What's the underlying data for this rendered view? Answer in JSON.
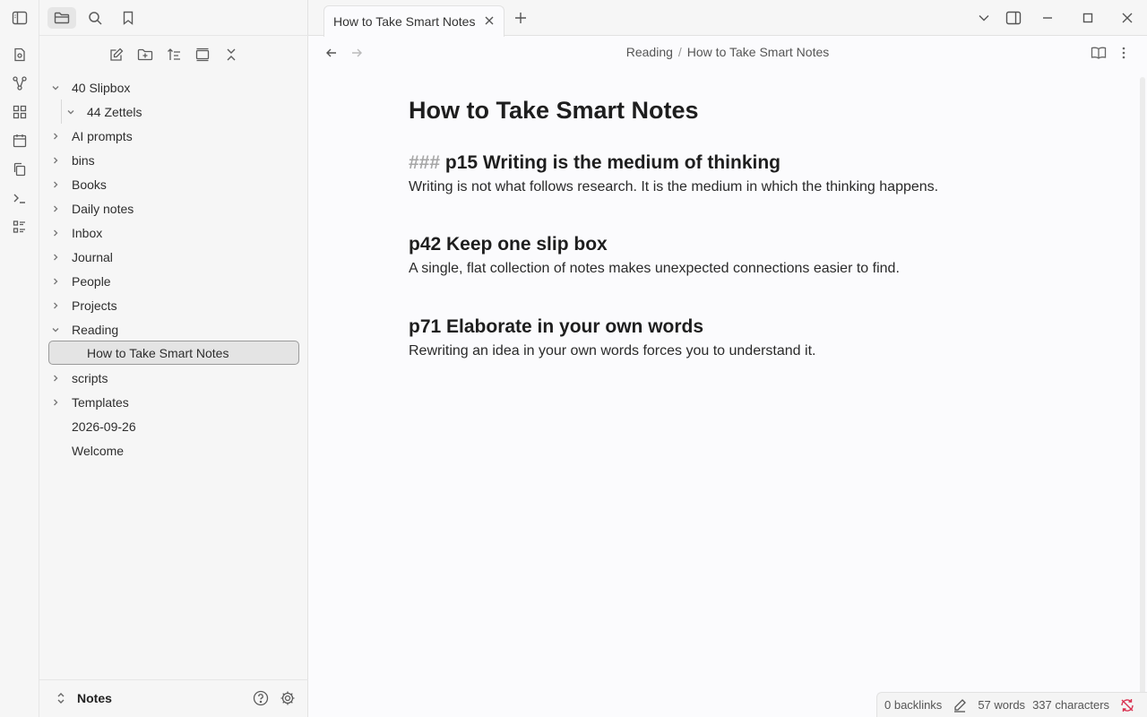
{
  "ribbon": {
    "icons": [
      "note-icon",
      "graph-icon",
      "canvas-icon",
      "calendar-icon",
      "copy-icon",
      "terminal-icon",
      "list-icon"
    ]
  },
  "sidebar": {
    "top_icons": [
      "sidebar-toggle-icon",
      "folder-icon",
      "search-icon",
      "bookmark-icon"
    ],
    "tools": [
      "new-note-icon",
      "new-folder-icon",
      "sort-icon",
      "collapse-icon",
      "close-icon"
    ],
    "tree": [
      {
        "label": "40 Slipbox",
        "level": 0,
        "expanded": true
      },
      {
        "label": "44 Zettels",
        "level": 1,
        "expanded": true
      },
      {
        "label": "AI prompts",
        "level": 0,
        "expanded": false
      },
      {
        "label": "bins",
        "level": 0,
        "expanded": false
      },
      {
        "label": "Books",
        "level": 0,
        "expanded": false
      },
      {
        "label": "Daily notes",
        "level": 0,
        "expanded": false
      },
      {
        "label": "Inbox",
        "level": 0,
        "expanded": false
      },
      {
        "label": "Journal",
        "level": 0,
        "expanded": false
      },
      {
        "label": "People",
        "level": 0,
        "expanded": false
      },
      {
        "label": "Projects",
        "level": 0,
        "expanded": false
      },
      {
        "label": "Reading",
        "level": 0,
        "expanded": true
      },
      {
        "label": "How to Take Smart Notes",
        "level": 1,
        "file": true,
        "selected": true
      },
      {
        "label": "scripts",
        "level": 0,
        "expanded": false
      },
      {
        "label": "Templates",
        "level": 0,
        "expanded": false
      },
      {
        "label": "2026-09-26",
        "level": 0,
        "file": true
      },
      {
        "label": "Welcome",
        "level": 0,
        "file": true
      }
    ],
    "vault_name": "Notes"
  },
  "tabs": {
    "active_label": "How to Take Smart Notes"
  },
  "header": {
    "breadcrumb_parent": "Reading",
    "breadcrumb_sep": "/",
    "breadcrumb_current": "How to Take Smart Notes"
  },
  "note": {
    "title": "How to Take Smart Notes",
    "sections": [
      {
        "marker": "###",
        "heading": "p15 Writing is the medium of thinking",
        "body": "Writing is not what follows research. It is the medium in which the thinking happens."
      },
      {
        "marker": "",
        "heading": "p42 Keep one slip box",
        "body": "A single, flat collection of notes makes unexpected connections easier to find."
      },
      {
        "marker": "",
        "heading": "p71 Elaborate in your own words",
        "body": "Rewriting an idea in your own words forces you to understand it."
      }
    ]
  },
  "status": {
    "backlinks": "0 backlinks",
    "words": "57 words",
    "characters": "337 characters"
  },
  "colors": {
    "background": "#fbfbfd",
    "sidebar": "#f6f6f6",
    "sync_error": "#d9304f"
  }
}
